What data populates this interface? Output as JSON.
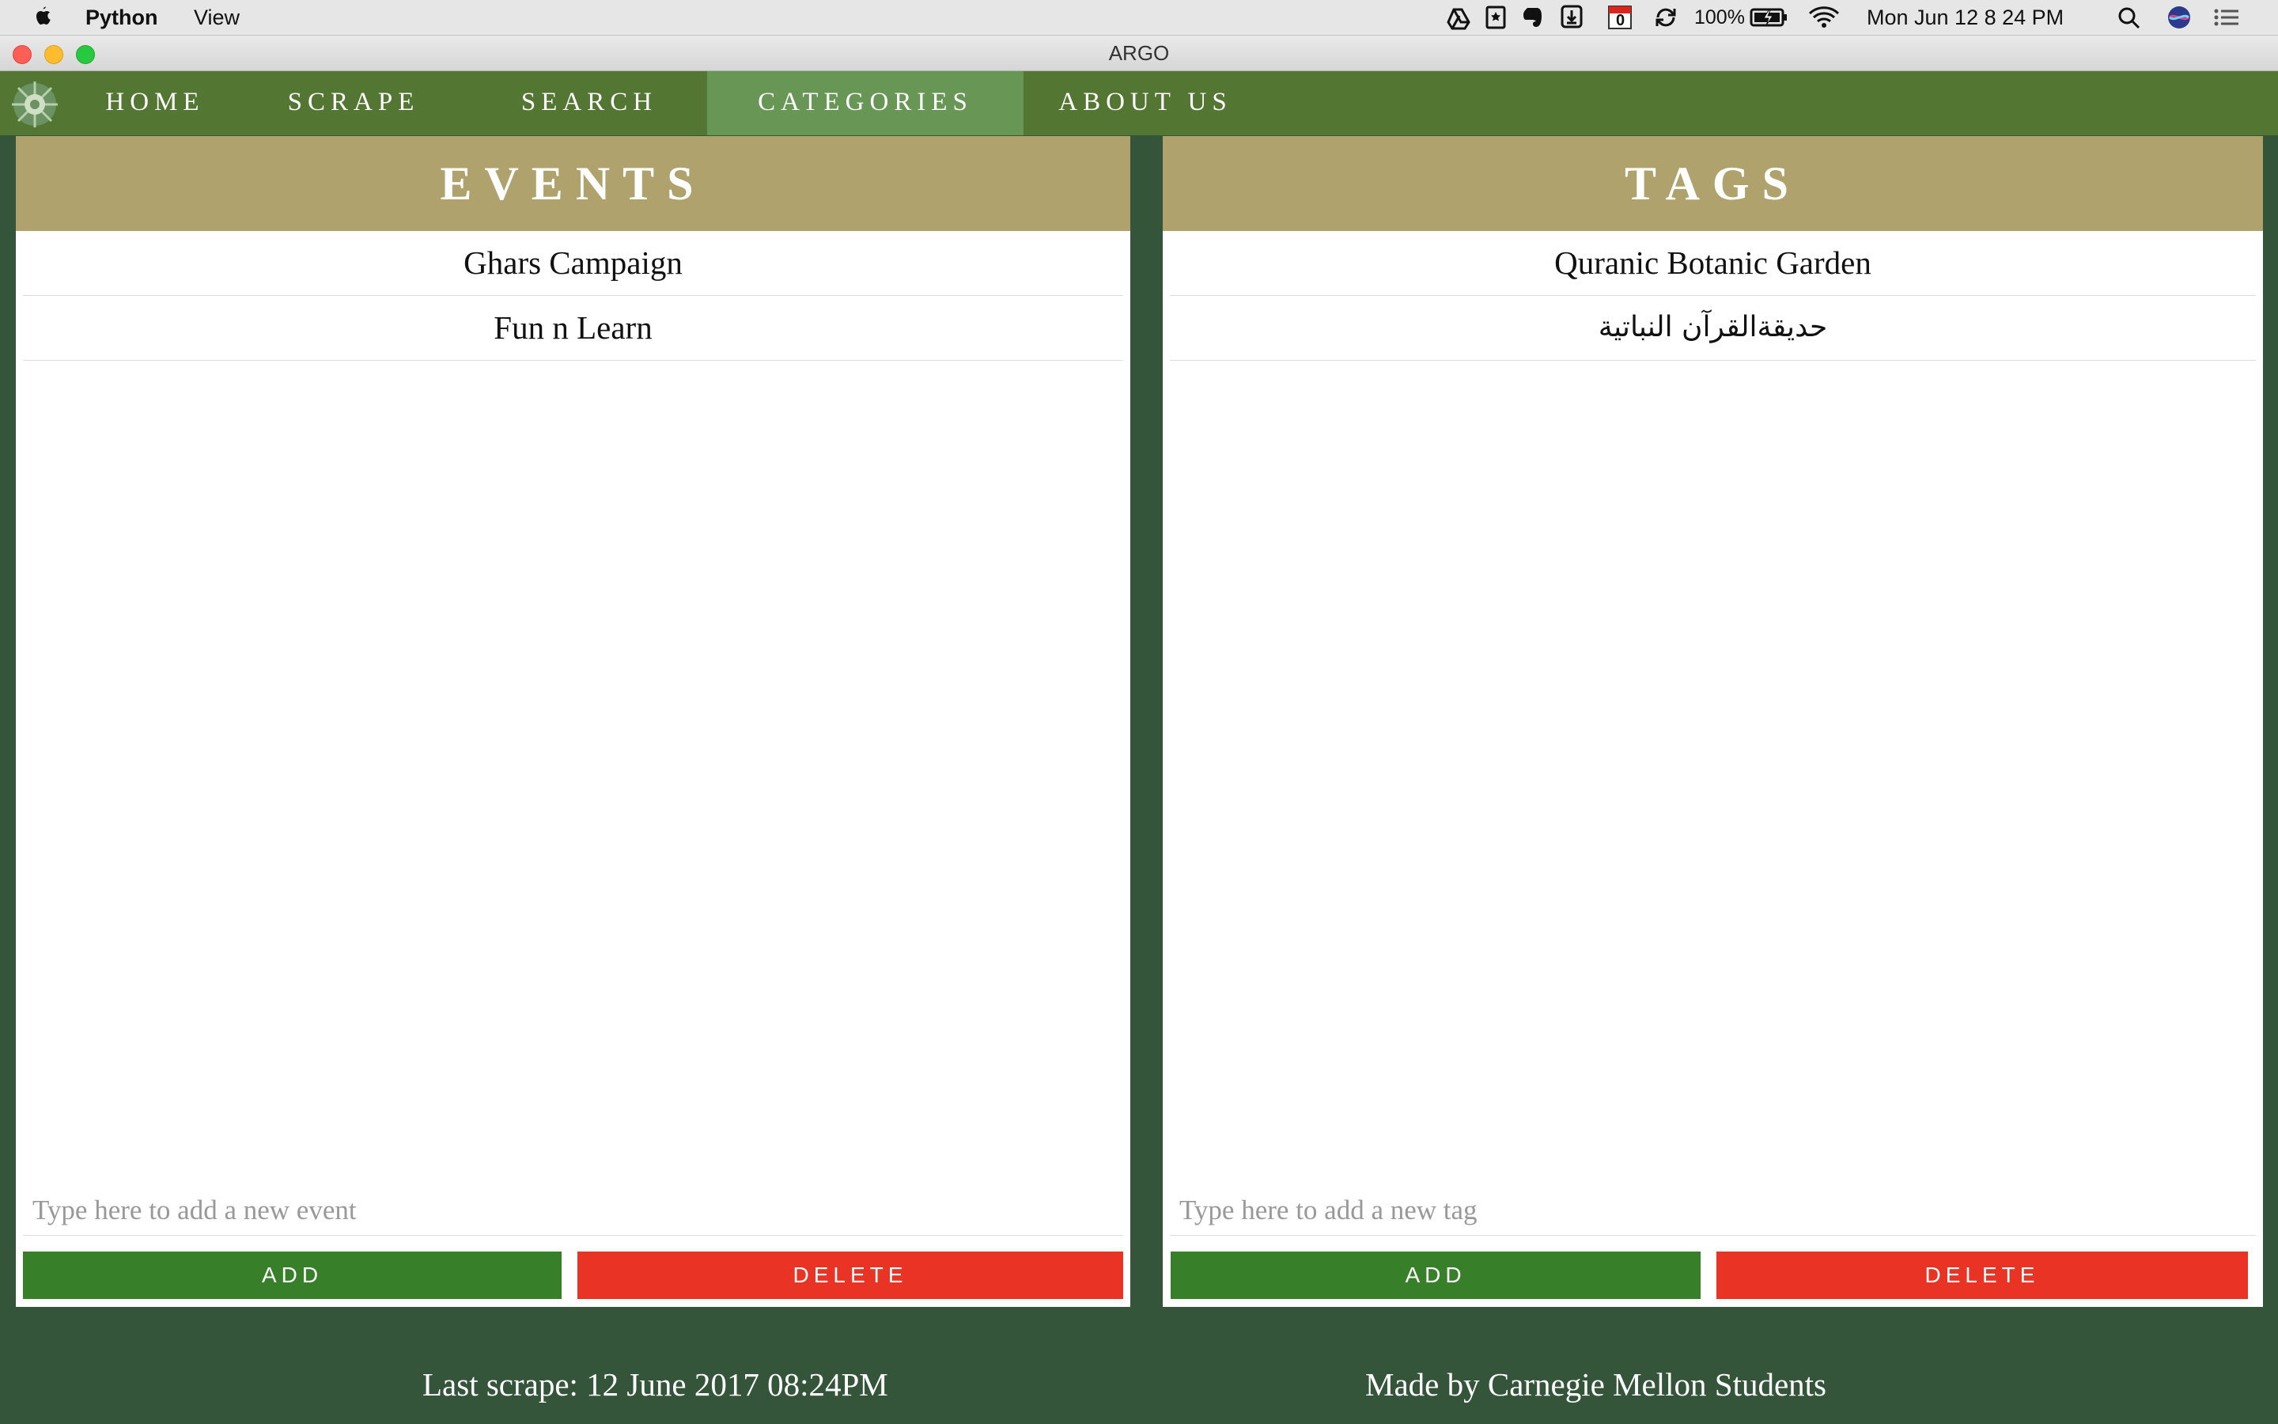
{
  "menubar": {
    "app_name": "Python",
    "menu_view": "View",
    "battery": "100%",
    "datetime": "Mon Jun 12  8 24 PM",
    "calendar_day": "0"
  },
  "window": {
    "title": "ARGO"
  },
  "nav": {
    "items": [
      {
        "label": "HOME"
      },
      {
        "label": "SCRAPE"
      },
      {
        "label": "SEARCH"
      },
      {
        "label": "CATEGORIES",
        "active": true
      },
      {
        "label": "ABOUT US"
      }
    ]
  },
  "events": {
    "title": "EVENTS",
    "items": [
      "Ghars Campaign",
      "Fun n Learn"
    ],
    "input_placeholder": "Type here to add a new event",
    "add_label": "ADD",
    "delete_label": "DELETE"
  },
  "tags": {
    "title": "TAGS",
    "items": [
      "Quranic Botanic Garden",
      "حديقةالقرآن النباتية"
    ],
    "input_placeholder": "Type here to add a new tag",
    "add_label": "ADD",
    "delete_label": "DELETE"
  },
  "footer": {
    "last_scrape": "Last scrape: 12 June 2017 08:24PM",
    "credits": "Made by Carnegie Mellon Students"
  },
  "colors": {
    "background": "#34553a",
    "navbar": "#537633",
    "nav_active": "#679655",
    "panel_header": "#afa26d",
    "add_button": "#387f29",
    "delete_button": "#e83325"
  }
}
